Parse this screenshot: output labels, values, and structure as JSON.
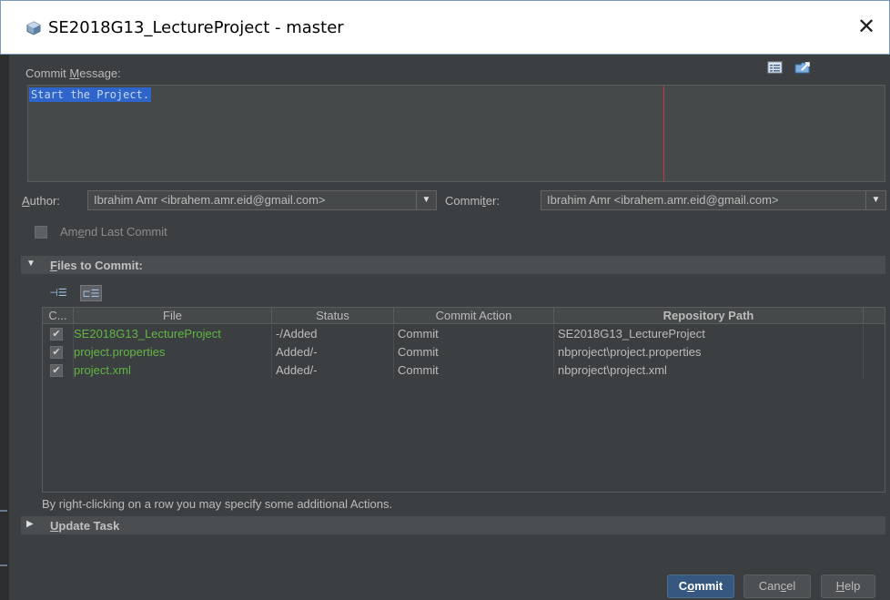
{
  "window": {
    "title": "SE2018G13_LectureProject - master",
    "close_symbol": "✕",
    "icon": "netbeans-cube-icon"
  },
  "commit_message": {
    "label_pre": "Commit ",
    "label_mnemonic": "M",
    "label_post": "essage:",
    "value": "Start the Project.",
    "toolbar_icons": [
      "recent-messages-icon",
      "load-template-icon"
    ]
  },
  "author": {
    "label_mnemonic": "A",
    "label_rest": "uthor:",
    "value": "Ibrahim Amr <ibrahem.amr.eid@gmail.com>"
  },
  "committer": {
    "label_pre": "Commi",
    "label_mnemonic": "t",
    "label_post": "er:",
    "value": "Ibrahim Amr <ibrahem.amr.eid@gmail.com>"
  },
  "amend": {
    "label_pre": "Am",
    "label_mnemonic": "e",
    "label_post": "nd Last Commit",
    "checked": false
  },
  "files_section": {
    "label_mnemonic": "F",
    "label_rest": "iles to Commit:",
    "expanded": true,
    "view_buttons": [
      "tree-view-icon",
      "flat-list-view-icon"
    ]
  },
  "table": {
    "columns": [
      "C...",
      "File",
      "Status",
      "Commit Action",
      "Repository Path"
    ],
    "rows": [
      {
        "checked": true,
        "file": "SE2018G13_LectureProject",
        "status": "-/Added",
        "action": "Commit",
        "path": "SE2018G13_LectureProject"
      },
      {
        "checked": true,
        "file": "project.properties",
        "status": "Added/-",
        "action": "Commit",
        "path": "nbproject\\project.properties"
      },
      {
        "checked": true,
        "file": "project.xml",
        "status": "Added/-",
        "action": "Commit",
        "path": "nbproject\\project.xml"
      }
    ]
  },
  "hint": "By right-clicking on a row you may specify some additional Actions.",
  "update_task": {
    "label_mnemonic": "U",
    "label_rest": "pdate Task",
    "expanded": false
  },
  "buttons": {
    "commit_pre": "C",
    "commit_mnemonic": "o",
    "commit_post": "mmit",
    "cancel_pre": "Can",
    "cancel_mnemonic": "c",
    "cancel_post": "el",
    "help_mnemonic": "H",
    "help_rest": "elp"
  },
  "colors": {
    "background": "#3c3f41",
    "added_file": "#62b543",
    "selection": "#2f65ca",
    "right_margin": "#bc3f3c",
    "primary_button": "#365880"
  }
}
